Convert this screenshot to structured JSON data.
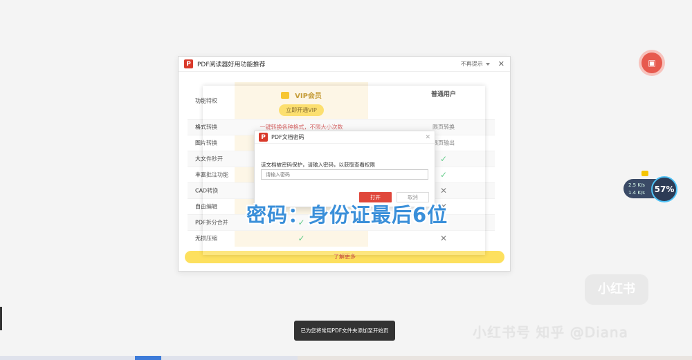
{
  "window": {
    "logo": "P",
    "title": "PDF阅读器好用功能推荐",
    "no_prompt": "不再提示",
    "close": "✕"
  },
  "table": {
    "feature_header": "功能特权",
    "vip_title": "VIP会员",
    "vip_button": "立即开通VIP",
    "normal_title": "普通用户",
    "rows": [
      {
        "feature": "格式转换",
        "vip": "一键转换各种格式，不限大小次数",
        "normal": "限页转换"
      },
      {
        "feature": "图片转换",
        "vip": "",
        "normal": "限页输出"
      },
      {
        "feature": "大文件秒开",
        "vip": "",
        "normal": "✓"
      },
      {
        "feature": "丰富批注功能",
        "vip": "",
        "normal": "✓"
      },
      {
        "feature": "CAD转换",
        "vip": "",
        "normal": "✕"
      },
      {
        "feature": "自由编辑",
        "vip": "",
        "normal": "✕"
      },
      {
        "feature": "PDF拆分合并",
        "vip": "✓",
        "normal": "✕"
      },
      {
        "feature": "无损压缩",
        "vip": "✓",
        "normal": "✕"
      }
    ],
    "learn_more": "了解更多"
  },
  "dialog": {
    "logo": "P",
    "title": "PDF文档密码",
    "close": "✕",
    "message": "该文档被密码保护，请输入密码，以获取查看权限",
    "placeholder": "请输入密码",
    "open": "打开",
    "cancel": "取消"
  },
  "caption": "密码：身份证最后6位",
  "network": {
    "upload": "2.5 K/s",
    "download": "1.4 K/s",
    "percent": "57%"
  },
  "toast": "已为您将常用PDF文件夹添加至开始页",
  "watermark": {
    "badge": "小红书",
    "text": "小红书号 知乎 @Diana"
  },
  "colors": {
    "accent_red": "#e0473b",
    "vip_gold": "#fde05e",
    "caption_blue": "#3a8fd9"
  }
}
